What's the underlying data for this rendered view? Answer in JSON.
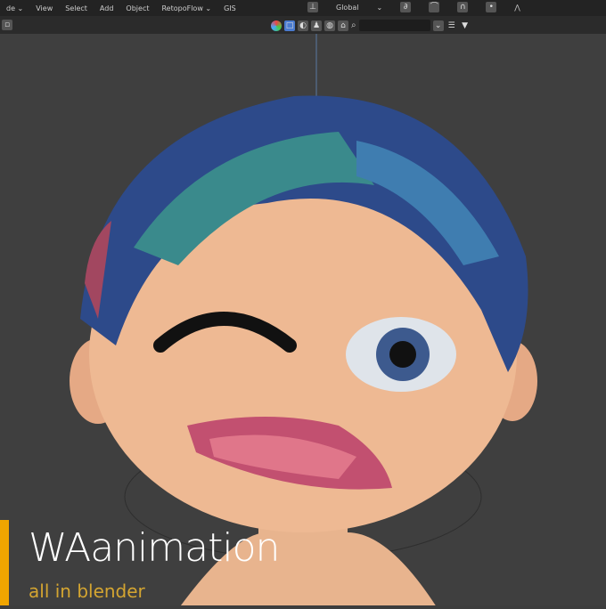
{
  "menubar": {
    "items": [
      "de ⌄",
      "View",
      "Select",
      "Add",
      "Object",
      "RetopoFlow ⌄",
      "GIS"
    ]
  },
  "toolbar": {
    "orientation": "Global",
    "search_placeholder": ""
  },
  "overlay": {
    "title": "WAanimation",
    "subtitle": "all in blender"
  },
  "colors": {
    "accent": "#f0a500",
    "subtitle": "#d4a531"
  }
}
